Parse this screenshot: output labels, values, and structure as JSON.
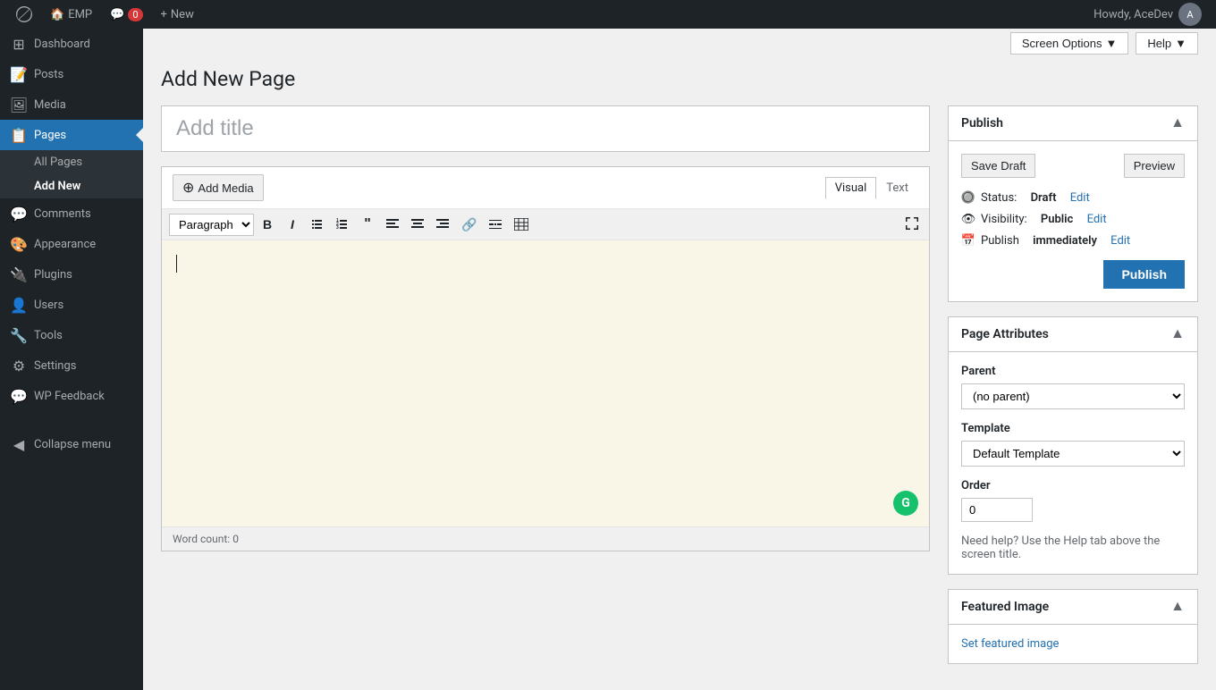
{
  "adminbar": {
    "wp_logo": "⊞",
    "site_name": "EMP",
    "comment_label": "0",
    "new_label": "New",
    "howdy": "Howdy, AceDev",
    "screen_options": "Screen Options",
    "help": "Help"
  },
  "sidebar": {
    "items": [
      {
        "id": "dashboard",
        "label": "Dashboard",
        "icon": "⊞"
      },
      {
        "id": "posts",
        "label": "Posts",
        "icon": "📄"
      },
      {
        "id": "media",
        "label": "Media",
        "icon": "🖼"
      },
      {
        "id": "pages",
        "label": "Pages",
        "icon": "📋",
        "active": true
      },
      {
        "id": "comments",
        "label": "Comments",
        "icon": "💬"
      },
      {
        "id": "appearance",
        "label": "Appearance",
        "icon": "🎨"
      },
      {
        "id": "plugins",
        "label": "Plugins",
        "icon": "🔌"
      },
      {
        "id": "users",
        "label": "Users",
        "icon": "👤"
      },
      {
        "id": "tools",
        "label": "Tools",
        "icon": "🔧"
      },
      {
        "id": "settings",
        "label": "Settings",
        "icon": "⚙"
      },
      {
        "id": "wp-feedback",
        "label": "WP Feedback",
        "icon": "💬"
      }
    ],
    "submenu": {
      "all_pages": "All Pages",
      "add_new": "Add New"
    },
    "collapse": "Collapse menu"
  },
  "page": {
    "title": "Add New Page",
    "title_placeholder": "Add title",
    "editor": {
      "add_media": "Add Media",
      "visual_tab": "Visual",
      "text_tab": "Text",
      "paragraph_select": "Paragraph",
      "word_count_label": "Word count:",
      "word_count_value": "0"
    }
  },
  "publish_panel": {
    "title": "Publish",
    "save_draft": "Save Draft",
    "preview": "Preview",
    "status_label": "Status:",
    "status_value": "Draft",
    "status_edit": "Edit",
    "visibility_label": "Visibility:",
    "visibility_value": "Public",
    "visibility_edit": "Edit",
    "publish_label": "Publish",
    "publish_time": "immediately",
    "publish_time_edit": "Edit",
    "publish_btn": "Publish"
  },
  "page_attributes": {
    "title": "Page Attributes",
    "parent_label": "Parent",
    "parent_value": "(no parent)",
    "template_label": "Template",
    "template_value": "Default Template",
    "order_label": "Order",
    "order_value": "0",
    "help_text": "Need help? Use the Help tab above the screen title."
  },
  "featured_image": {
    "title": "Featured Image",
    "set_link": "Set featured image"
  }
}
